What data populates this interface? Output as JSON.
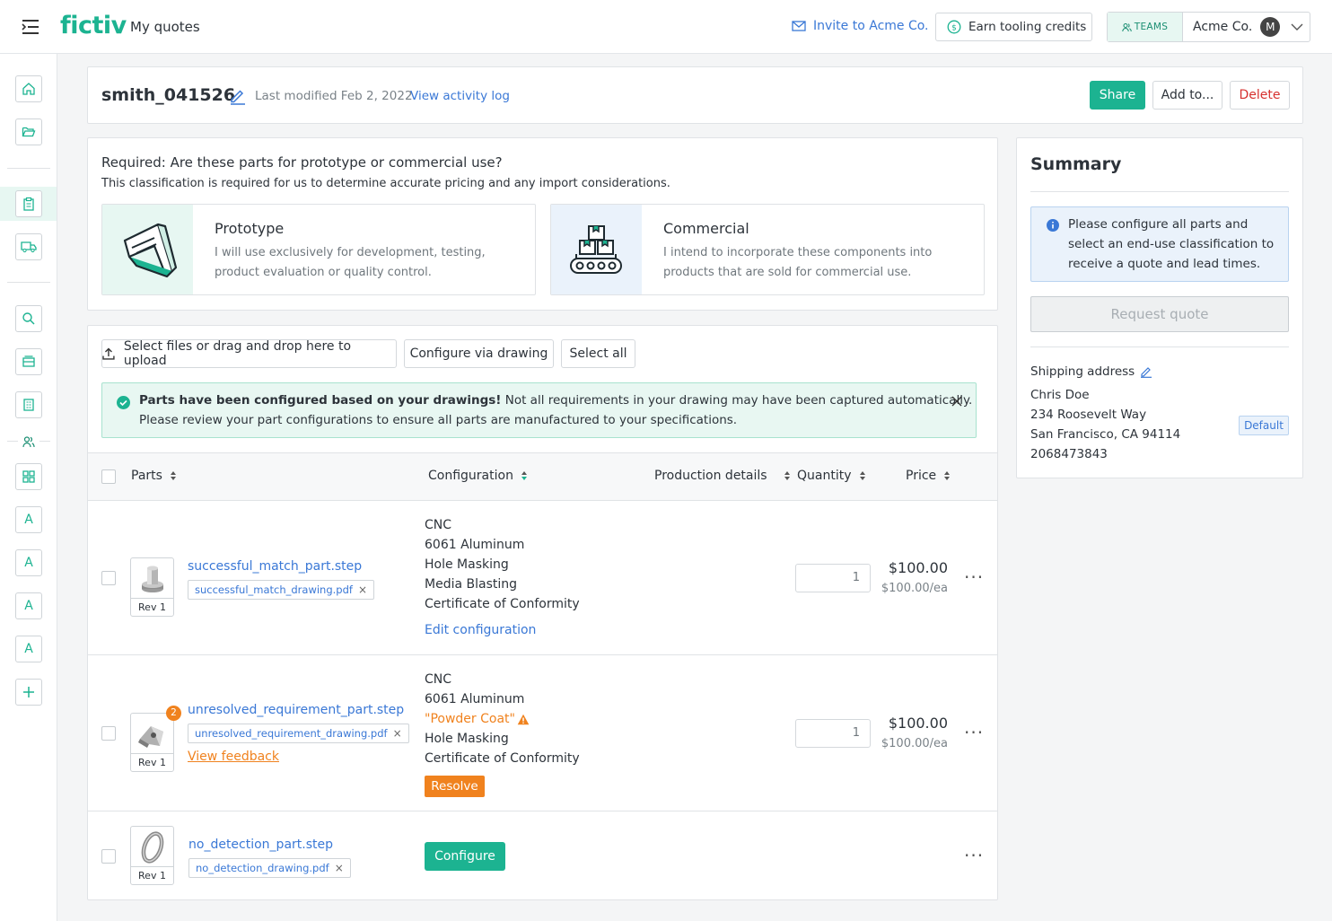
{
  "header": {
    "logo": "fictiv",
    "page_title": "My quotes",
    "invite_label": "Invite to Acme Co.",
    "earn_label": "Earn tooling credits",
    "teams_label": "TEAMS",
    "account_name": "Acme Co.",
    "avatar_initial": "M"
  },
  "sidebar": {
    "letters": [
      "A",
      "A",
      "A",
      "A"
    ]
  },
  "quote": {
    "name": "smith_041526",
    "last_modified": "Last modified Feb 2, 2022",
    "activity_link": "View activity log",
    "share_label": "Share",
    "add_label": "Add to...",
    "delete_label": "Delete"
  },
  "classification": {
    "heading": "Required: Are these parts for prototype or commercial use?",
    "subheading": "This classification is required for us to determine accurate pricing and any import considerations.",
    "prototype_title": "Prototype",
    "prototype_desc": "I will use exclusively for development, testing, product evaluation or quality control.",
    "commercial_title": "Commercial",
    "commercial_desc": "I intend to incorporate these components into products that are sold for commercial use."
  },
  "toolbar": {
    "upload_label": "Select files or drag and drop here to upload",
    "drawing_label": "Configure via drawing",
    "select_all_label": "Select all"
  },
  "alert": {
    "bold": "Parts have been configured based on your drawings!",
    "text1": " Not all requirements in your drawing may have been captured automatically.",
    "text2": "Please review your part configurations to ensure all parts are manufactured to your specifications."
  },
  "table": {
    "headers": {
      "parts": "Parts",
      "configuration": "Configuration",
      "production": "Production details",
      "quantity": "Quantity",
      "price": "Price"
    },
    "rows": [
      {
        "rev": "Rev 1",
        "part_name": "successful_match_part.step",
        "drawing": "successful_match_drawing.pdf",
        "config": [
          "CNC",
          "6061 Aluminum",
          "Hole Masking",
          "Media Blasting",
          "Certificate of Conformity"
        ],
        "action_link": "Edit configuration",
        "quantity": "1",
        "price": "$100.00",
        "price_each": "$100.00/ea"
      },
      {
        "rev": "Rev 1",
        "badge": "2",
        "part_name": "unresolved_requirement_part.step",
        "drawing": "unresolved_requirement_drawing.pdf",
        "feedback_link": "View feedback",
        "config": [
          "CNC",
          "6061 Aluminum",
          "\"Powder Coat\"",
          "Hole Masking",
          "Certificate of Conformity"
        ],
        "resolve_label": "Resolve",
        "quantity": "1",
        "price": "$100.00",
        "price_each": "$100.00/ea"
      },
      {
        "rev": "Rev 1",
        "part_name": "no_detection_part.step",
        "drawing": "no_detection_drawing.pdf",
        "configure_label": "Configure"
      }
    ]
  },
  "summary": {
    "title": "Summary",
    "info": "Please configure all parts and select an end-use classification to receive a quote and lead times.",
    "request_label": "Request quote",
    "shipping_label": "Shipping address",
    "name": "Chris Doe",
    "street": "234 Roosevelt Way",
    "city": "San Francisco, CA 94114",
    "phone": "2068473843",
    "default_label": "Default"
  },
  "colors": {
    "brand": "#1cb391",
    "link": "#3a78d6",
    "warning": "#f0821e",
    "delete": "#d6302e"
  }
}
